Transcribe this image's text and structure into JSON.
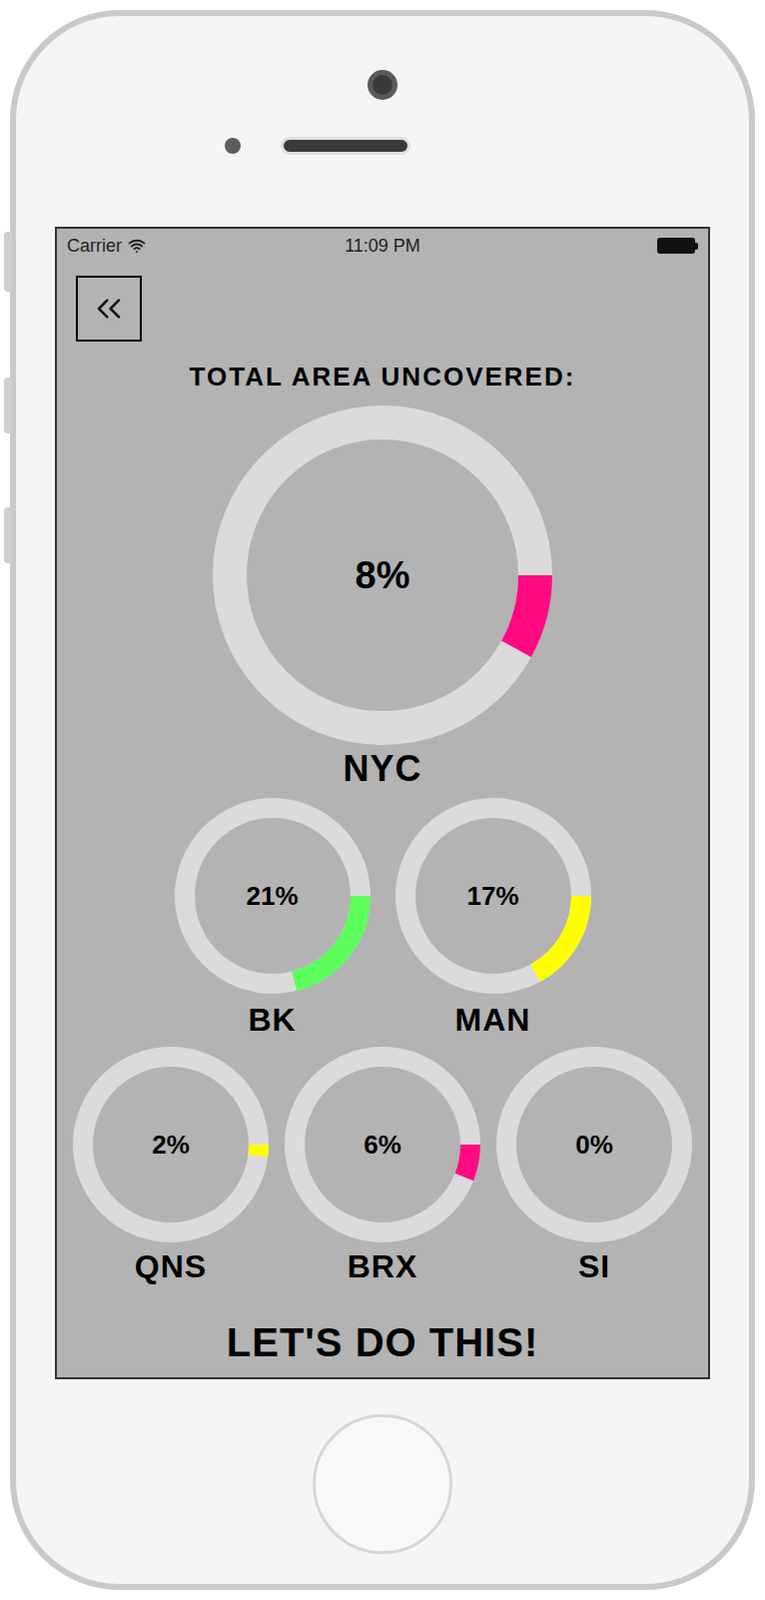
{
  "status_bar": {
    "carrier": "Carrier",
    "time": "11:09 PM"
  },
  "title": "TOTAL AREA UNCOVERED:",
  "total": {
    "label": "NYC",
    "reading": "8%",
    "level": 0.08,
    "color": "#ff0a80"
  },
  "boroughs": [
    {
      "label": "BK",
      "reading": "21%",
      "level": 0.21,
      "color": "#5cff5c"
    },
    {
      "label": "MAN",
      "reading": "17%",
      "level": 0.17,
      "color": "#ffff00"
    },
    {
      "label": "QNS",
      "reading": "2%",
      "level": 0.02,
      "color": "#ffff00"
    },
    {
      "label": "BRX",
      "reading": "6%",
      "level": 0.06,
      "color": "#ff0a80"
    },
    {
      "label": "SI",
      "reading": "0%",
      "level": 0,
      "color": "#ff0a80"
    }
  ],
  "action": "LET'S DO THIS!"
}
